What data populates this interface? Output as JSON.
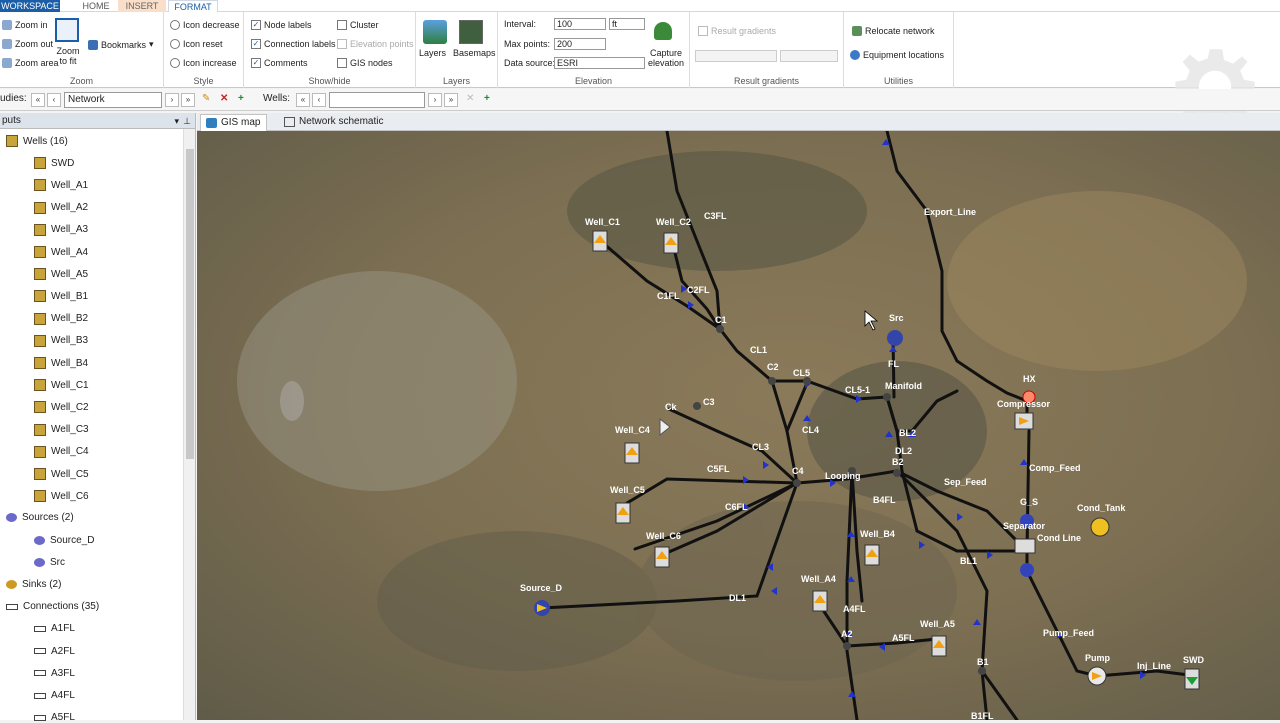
{
  "tabs": {
    "workspace": "WORKSPACE",
    "home": "HOME",
    "insert": "INSERT",
    "format": "FORMAT"
  },
  "zoom": {
    "in": "Zoom in",
    "out": "Zoom out",
    "area": "Zoom area",
    "fit": "Zoom to fit",
    "title": "Zoom",
    "bookmarks": "Bookmarks"
  },
  "style": {
    "decrease": "Icon decrease",
    "reset": "Icon reset",
    "increase": "Icon increase",
    "title": "Style"
  },
  "showhide": {
    "node_labels": "Node labels",
    "connection_labels": "Connection labels",
    "comments": "Comments",
    "cluster": "Cluster",
    "elevation_points": "Elevation points",
    "gis_nodes": "GIS nodes",
    "title": "Show/hide"
  },
  "layers": {
    "layers": "Layers",
    "basemaps": "Basemaps",
    "title": "Layers"
  },
  "elevation": {
    "interval_label": "Interval:",
    "interval_value": "100",
    "interval_unit": "ft",
    "max_points_label": "Max points:",
    "max_points_value": "200",
    "source_label": "Data source:",
    "source_value": "ESRI",
    "capture": "Capture elevation",
    "title": "Elevation"
  },
  "result_gradients": {
    "label": "Result gradients",
    "title": "Result gradients"
  },
  "utilities": {
    "relocate": "Relocate network",
    "equipment": "Equipment locations",
    "title": "Utilities"
  },
  "toolbar": {
    "studies_label": "udies:",
    "study_value": "Network",
    "wells_label": "Wells:"
  },
  "inputs": {
    "header": "puts",
    "wells": "Wells (16)",
    "well_items": [
      "SWD",
      "Well_A1",
      "Well_A2",
      "Well_A3",
      "Well_A4",
      "Well_A5",
      "Well_B1",
      "Well_B2",
      "Well_B3",
      "Well_B4",
      "Well_C1",
      "Well_C2",
      "Well_C3",
      "Well_C4",
      "Well_C5",
      "Well_C6"
    ],
    "sources": "Sources (2)",
    "source_items": [
      "Source_D",
      "Src"
    ],
    "sinks": "Sinks (2)",
    "connections": "Connections (35)",
    "connection_items": [
      "A1FL",
      "A2FL",
      "A3FL",
      "A4FL",
      "A5FL"
    ]
  },
  "map_tabs": {
    "gis": "GIS map",
    "schematic": "Network schematic"
  },
  "map_labels": [
    {
      "id": "well_c1",
      "text": "Well_C1"
    },
    {
      "id": "well_c2",
      "text": "Well_C2"
    },
    {
      "id": "c3fl",
      "text": "C3FL"
    },
    {
      "id": "export",
      "text": "Export_Line"
    },
    {
      "id": "c1fl",
      "text": "C1FL"
    },
    {
      "id": "c2fl",
      "text": "C2FL"
    },
    {
      "id": "c1",
      "text": "C1"
    },
    {
      "id": "src",
      "text": "Src"
    },
    {
      "id": "cl1",
      "text": "CL1"
    },
    {
      "id": "c2",
      "text": "C2"
    },
    {
      "id": "cl5",
      "text": "CL5"
    },
    {
      "id": "cl51",
      "text": "CL5-1"
    },
    {
      "id": "manifold",
      "text": "Manifold"
    },
    {
      "id": "fl",
      "text": "FL"
    },
    {
      "id": "hx",
      "text": "HX"
    },
    {
      "id": "compressor",
      "text": "Compressor"
    },
    {
      "id": "ck",
      "text": "Ck"
    },
    {
      "id": "c3",
      "text": "C3"
    },
    {
      "id": "well_c4",
      "text": "Well_C4"
    },
    {
      "id": "cl4",
      "text": "CL4"
    },
    {
      "id": "bl2",
      "text": "BL2"
    },
    {
      "id": "dl2",
      "text": "DL2"
    },
    {
      "id": "cl3",
      "text": "CL3"
    },
    {
      "id": "c5fl",
      "text": "C5FL"
    },
    {
      "id": "c4",
      "text": "C4"
    },
    {
      "id": "looping",
      "text": "Looping"
    },
    {
      "id": "comp_feed",
      "text": "Comp_Feed"
    },
    {
      "id": "well_c5",
      "text": "Well_C5"
    },
    {
      "id": "c6fl",
      "text": "C6FL"
    },
    {
      "id": "b4fl",
      "text": "B4FL"
    },
    {
      "id": "sep_feed",
      "text": "Sep_Feed"
    },
    {
      "id": "g_s",
      "text": "G_S"
    },
    {
      "id": "cond_tank",
      "text": "Cond_Tank"
    },
    {
      "id": "separator",
      "text": "Separator"
    },
    {
      "id": "cond_line",
      "text": "Cond Line"
    },
    {
      "id": "well_c6",
      "text": "Well_C6"
    },
    {
      "id": "well_b4",
      "text": "Well_B4"
    },
    {
      "id": "bl1",
      "text": "BL1"
    },
    {
      "id": "source_d",
      "text": "Source_D"
    },
    {
      "id": "dl1",
      "text": "DL1"
    },
    {
      "id": "well_a4",
      "text": "Well_A4"
    },
    {
      "id": "a4fl",
      "text": "A4FL"
    },
    {
      "id": "a2",
      "text": "A2"
    },
    {
      "id": "a5fl",
      "text": "A5FL"
    },
    {
      "id": "well_a5",
      "text": "Well_A5"
    },
    {
      "id": "pump_feed",
      "text": "Pump_Feed"
    },
    {
      "id": "pump",
      "text": "Pump"
    },
    {
      "id": "inj_line",
      "text": "Inj_Line"
    },
    {
      "id": "swd",
      "text": "SWD"
    },
    {
      "id": "b1",
      "text": "B1"
    },
    {
      "id": "b1fl",
      "text": "B1FL"
    },
    {
      "id": "b2",
      "text": "B2"
    }
  ]
}
